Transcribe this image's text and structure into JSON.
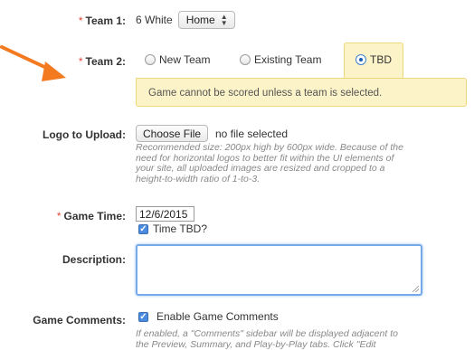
{
  "team1": {
    "required_mark": "*",
    "label": "Team 1:",
    "team_name": "6 White",
    "location_select": "Home"
  },
  "team2": {
    "required_mark": "*",
    "label": "Team 2:",
    "options": [
      "New Team",
      "Existing Team",
      "TBD"
    ],
    "selected": "TBD",
    "message": "Game cannot be scored unless a team is selected."
  },
  "logo": {
    "label": "Logo to Upload:",
    "button": "Choose File",
    "status": "no file selected",
    "help_lines": [
      "Recommended size: 200px high by 600px wide. Because of the",
      "need for horizontal logos to better fit within the UI elements of",
      "your site, all uploaded images are resized and cropped to a",
      "height-to-width ratio of 1-to-3."
    ]
  },
  "game_time": {
    "required_mark": "*",
    "label": "Game Time:",
    "date_value": "12/6/2015",
    "tbd_checkbox_label": "Time TBD?",
    "tbd_checked": true
  },
  "description": {
    "label": "Description:",
    "value": ""
  },
  "comments": {
    "label": "Game Comments:",
    "checkbox_label": "Enable Game Comments",
    "checked": true,
    "help_lines": [
      "If enabled, a \"Comments\" sidebar will be displayed adjacent to",
      "the Preview, Summary, and Play-by-Play tabs. Click \"Edit"
    ]
  },
  "colors": {
    "arrow": "#f47a20",
    "required": "#e8443a",
    "notice_bg": "#fcf4c8",
    "notice_border": "#efd87a",
    "focus_border": "#76a9ea"
  }
}
